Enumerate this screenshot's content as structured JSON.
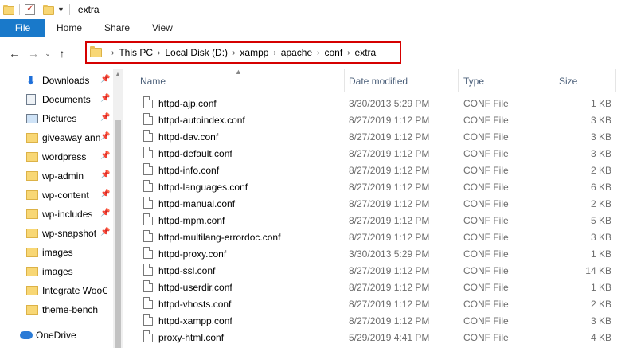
{
  "window": {
    "title": "extra"
  },
  "ribbon": {
    "tabs": [
      "File",
      "Home",
      "Share",
      "View"
    ]
  },
  "address": {
    "crumbs": [
      "This PC",
      "Local Disk (D:)",
      "xampp",
      "apache",
      "conf",
      "extra"
    ]
  },
  "sidebar": {
    "items": [
      {
        "label": "Downloads",
        "icon": "download-icon",
        "pinned": true
      },
      {
        "label": "Documents",
        "icon": "document-icon",
        "pinned": true
      },
      {
        "label": "Pictures",
        "icon": "picture-icon",
        "pinned": true
      },
      {
        "label": "giveaway ann",
        "icon": "folder-icon",
        "pinned": true
      },
      {
        "label": "wordpress",
        "icon": "folder-icon",
        "pinned": true
      },
      {
        "label": "wp-admin",
        "icon": "folder-icon",
        "pinned": true
      },
      {
        "label": "wp-content",
        "icon": "folder-icon",
        "pinned": true
      },
      {
        "label": "wp-includes",
        "icon": "folder-icon",
        "pinned": true
      },
      {
        "label": "wp-snapshot",
        "icon": "folder-icon",
        "pinned": true
      },
      {
        "label": "images",
        "icon": "folder-icon",
        "pinned": false
      },
      {
        "label": "images",
        "icon": "folder-icon",
        "pinned": false
      },
      {
        "label": "Integrate WooCo",
        "icon": "folder-icon",
        "pinned": false
      },
      {
        "label": "theme-bench",
        "icon": "folder-icon",
        "pinned": false
      }
    ],
    "onedrive": "OneDrive"
  },
  "columns": {
    "name": "Name",
    "date": "Date modified",
    "type": "Type",
    "size": "Size"
  },
  "files": [
    {
      "name": "httpd-ajp.conf",
      "date": "3/30/2013 5:29 PM",
      "type": "CONF File",
      "size": "1 KB"
    },
    {
      "name": "httpd-autoindex.conf",
      "date": "8/27/2019 1:12 PM",
      "type": "CONF File",
      "size": "3 KB"
    },
    {
      "name": "httpd-dav.conf",
      "date": "8/27/2019 1:12 PM",
      "type": "CONF File",
      "size": "3 KB"
    },
    {
      "name": "httpd-default.conf",
      "date": "8/27/2019 1:12 PM",
      "type": "CONF File",
      "size": "3 KB"
    },
    {
      "name": "httpd-info.conf",
      "date": "8/27/2019 1:12 PM",
      "type": "CONF File",
      "size": "2 KB"
    },
    {
      "name": "httpd-languages.conf",
      "date": "8/27/2019 1:12 PM",
      "type": "CONF File",
      "size": "6 KB"
    },
    {
      "name": "httpd-manual.conf",
      "date": "8/27/2019 1:12 PM",
      "type": "CONF File",
      "size": "2 KB"
    },
    {
      "name": "httpd-mpm.conf",
      "date": "8/27/2019 1:12 PM",
      "type": "CONF File",
      "size": "5 KB"
    },
    {
      "name": "httpd-multilang-errordoc.conf",
      "date": "8/27/2019 1:12 PM",
      "type": "CONF File",
      "size": "3 KB"
    },
    {
      "name": "httpd-proxy.conf",
      "date": "3/30/2013 5:29 PM",
      "type": "CONF File",
      "size": "1 KB"
    },
    {
      "name": "httpd-ssl.conf",
      "date": "8/27/2019 1:12 PM",
      "type": "CONF File",
      "size": "14 KB"
    },
    {
      "name": "httpd-userdir.conf",
      "date": "8/27/2019 1:12 PM",
      "type": "CONF File",
      "size": "1 KB"
    },
    {
      "name": "httpd-vhosts.conf",
      "date": "8/27/2019 1:12 PM",
      "type": "CONF File",
      "size": "2 KB"
    },
    {
      "name": "httpd-xampp.conf",
      "date": "8/27/2019 1:12 PM",
      "type": "CONF File",
      "size": "3 KB"
    },
    {
      "name": "proxy-html.conf",
      "date": "5/29/2019 4:41 PM",
      "type": "CONF File",
      "size": "4 KB"
    }
  ]
}
